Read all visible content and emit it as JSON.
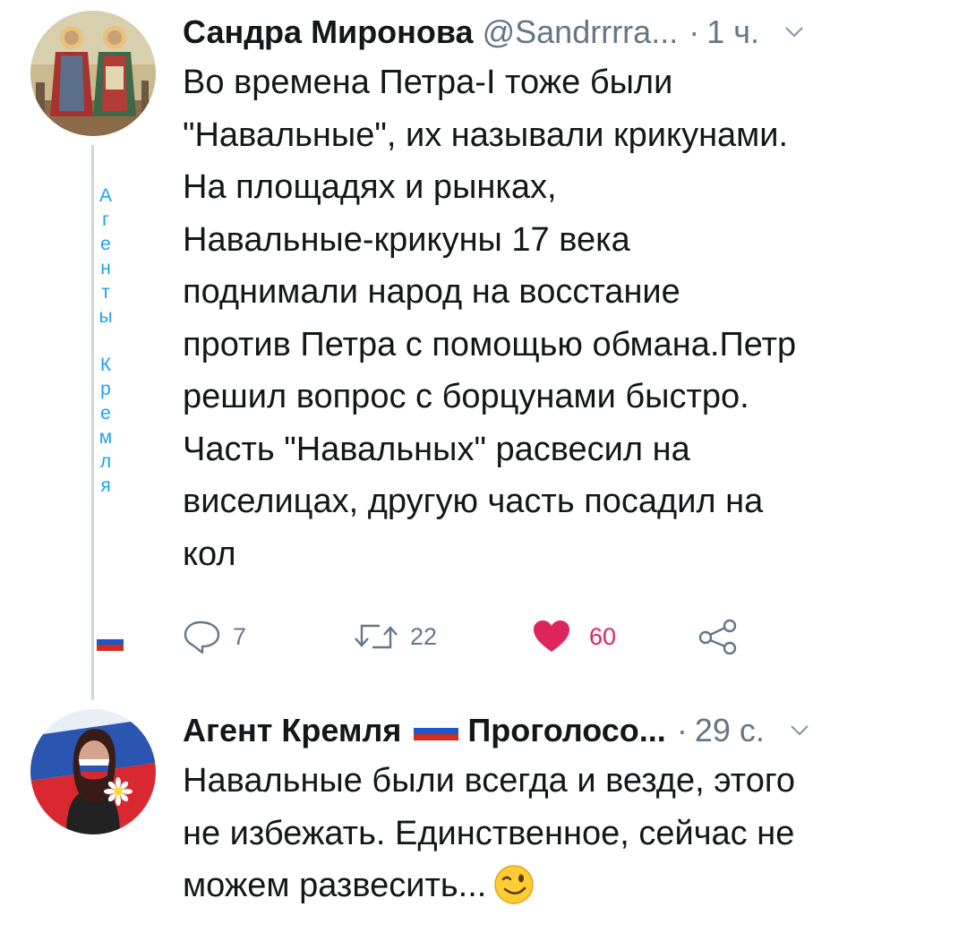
{
  "tweets": [
    {
      "author": {
        "display_name": "Сандра Миронова",
        "handle": "@Sandrrrra...",
        "avatar_icon": "saints-icon-avatar"
      },
      "time": "1 ч.",
      "separator": "·",
      "text": "Во времена Петра-I тоже были\n\"Навальные\", их называли крикунами.\nНа площадях и рынках,\nНавальные-крикуны 17 века\nподнимали народ на восстание\nпротив Петра с помощью обмана.Петр\nрешил вопрос с борцунами быстро.\nЧасть \"Навальных\" расвесил на\nвиселицах, другую часть посадил на\nкол",
      "actions": {
        "replies": "7",
        "retweets": "22",
        "likes": "60",
        "liked": true
      }
    },
    {
      "author": {
        "display_name": "Агент Кремля",
        "name_suffix": "Проголосо...",
        "flag_icon": "russia-flag-icon",
        "avatar_icon": "woman-with-flag-avatar"
      },
      "time": "29 с.",
      "separator": "·",
      "text": "Навальные были всегда и везде, этого\nне избежать. Единственное, сейчас не\nможем развесить...",
      "emoji_icon": "winking-face-icon"
    }
  ],
  "thread_label": {
    "letters": [
      "А",
      "г",
      "е",
      "н",
      "т",
      "ы",
      "",
      "К",
      "р",
      "е",
      "м",
      "л",
      "я"
    ],
    "flag_icon": "russia-flag-icon"
  },
  "colors": {
    "text": "#14171a",
    "secondary": "#657786",
    "like": "#e0245e",
    "link": "#1da1f2",
    "thread_line": "#ccd6dd"
  }
}
